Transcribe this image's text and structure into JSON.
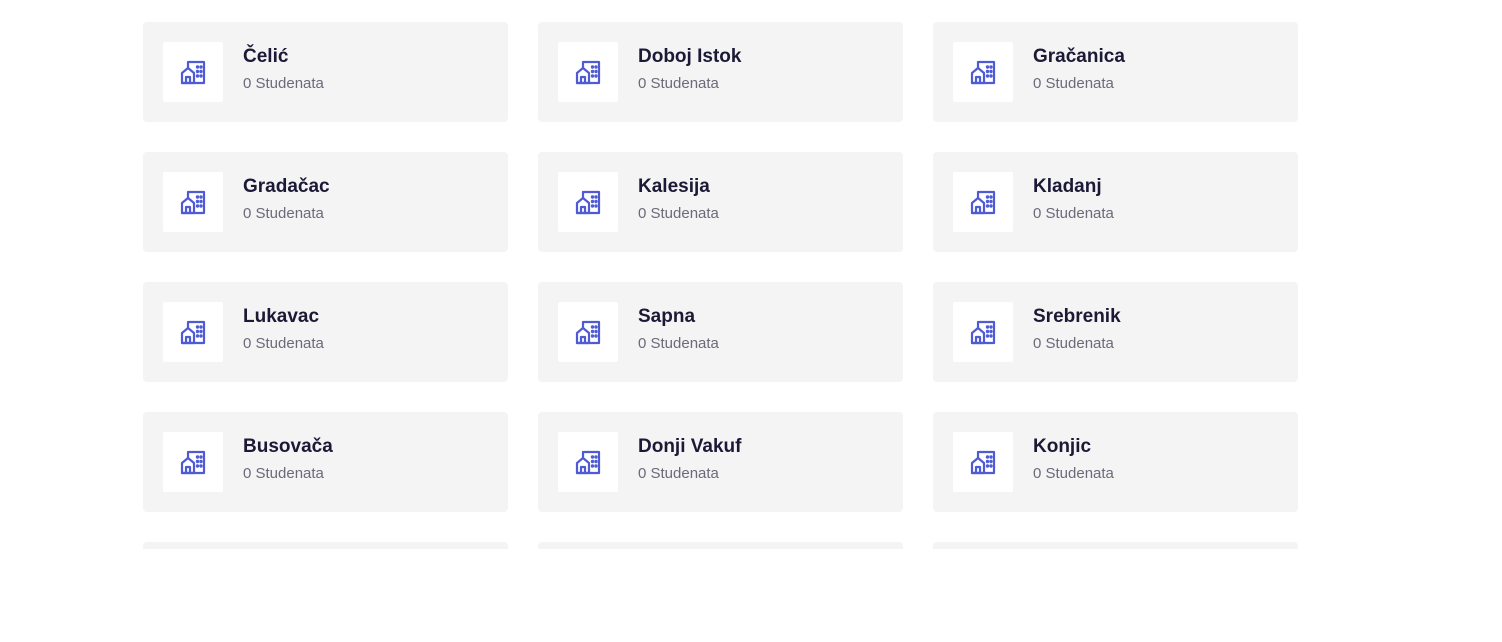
{
  "accent_color": "#4f5bd5",
  "icon": "building-icon",
  "cities": [
    {
      "name": "Čelić",
      "count": "0 Studenata"
    },
    {
      "name": "Doboj Istok",
      "count": "0 Studenata"
    },
    {
      "name": "Gračanica",
      "count": "0 Studenata"
    },
    {
      "name": "Gradačac",
      "count": "0 Studenata"
    },
    {
      "name": "Kalesija",
      "count": "0 Studenata"
    },
    {
      "name": "Kladanj",
      "count": "0 Studenata"
    },
    {
      "name": "Lukavac",
      "count": "0 Studenata"
    },
    {
      "name": "Sapna",
      "count": "0 Studenata"
    },
    {
      "name": "Srebrenik",
      "count": "0 Studenata"
    },
    {
      "name": "Busovača",
      "count": "0 Studenata"
    },
    {
      "name": "Donji Vakuf",
      "count": "0 Studenata"
    },
    {
      "name": "Konjic",
      "count": "0 Studenata"
    }
  ]
}
